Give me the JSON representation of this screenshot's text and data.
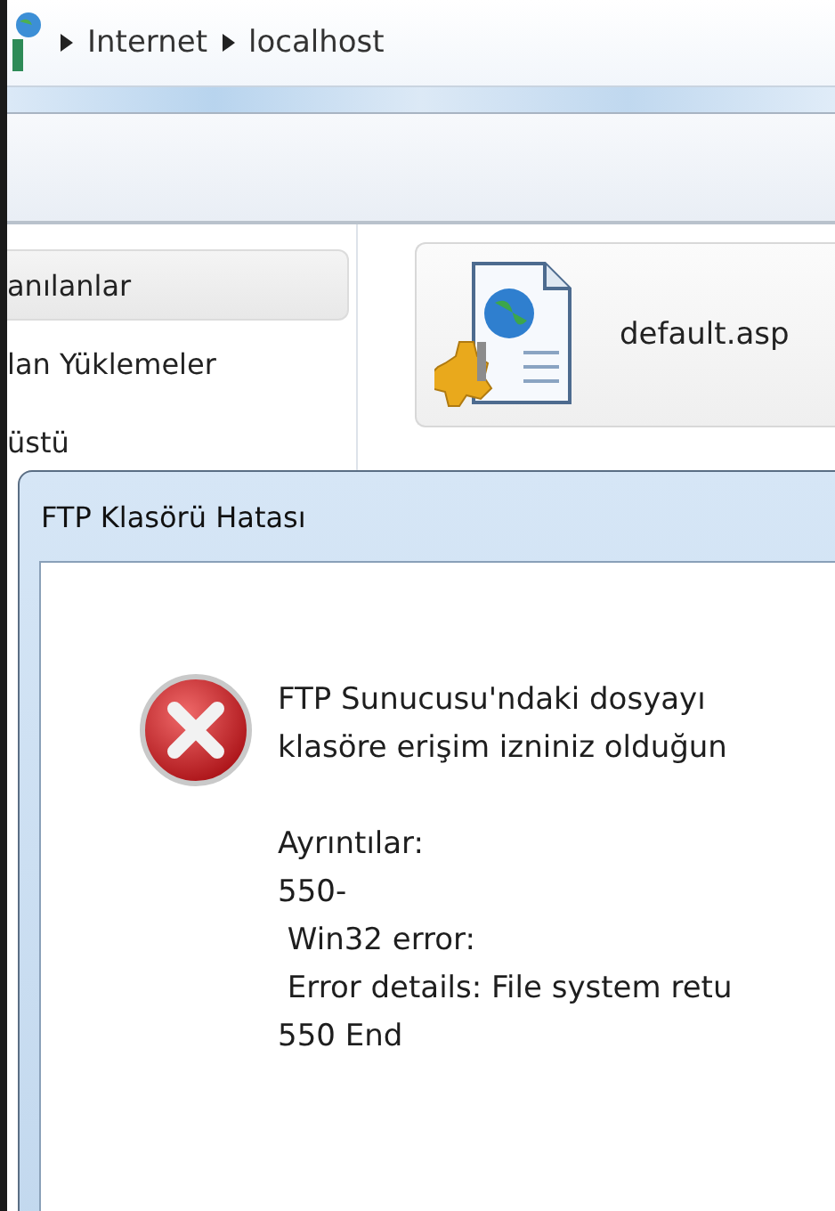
{
  "address_bar": {
    "crumbs": [
      "Internet",
      "localhost"
    ]
  },
  "nav_pane": {
    "items": [
      {
        "label": "anılanlar",
        "selected": true
      },
      {
        "label": "lan Yüklemeler",
        "selected": false
      },
      {
        "label": "üstü",
        "selected": false
      }
    ]
  },
  "files": [
    {
      "name": "default.asp",
      "selected": true
    }
  ],
  "dialog": {
    "title": "FTP Klasörü Hatası",
    "message": [
      "FTP Sunucusu'ndaki dosyayı",
      "klasöre erişim izniniz olduğun"
    ],
    "details": [
      "Ayrıntılar:",
      "550-",
      " Win32 error:",
      " Error details: File system retu",
      "550 End"
    ]
  }
}
